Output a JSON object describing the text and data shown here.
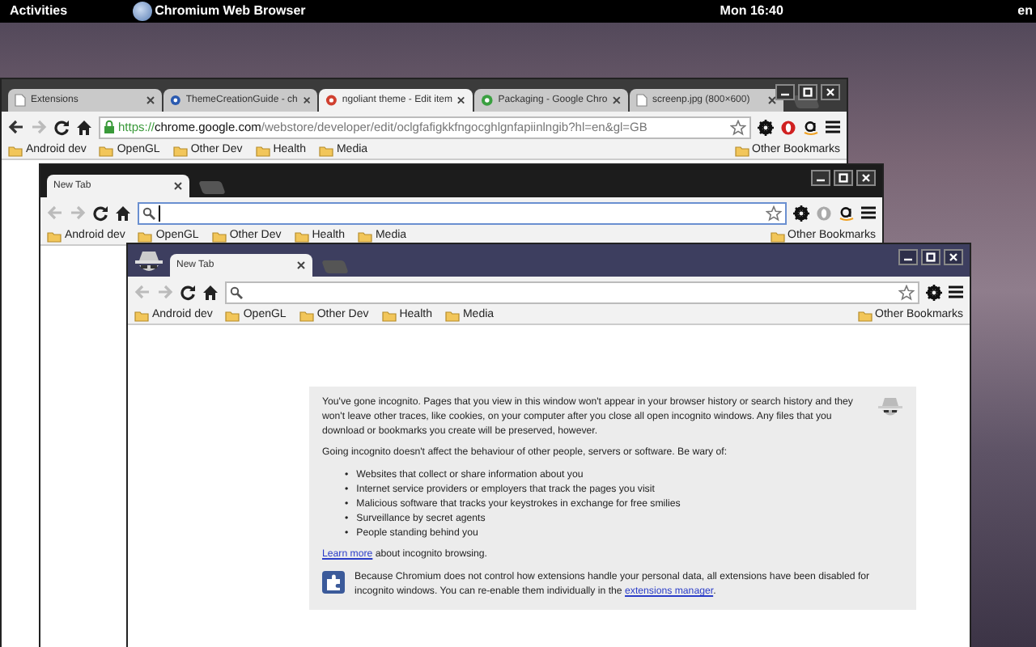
{
  "top_bar": {
    "activities": "Activities",
    "app_name": "Chromium Web Browser",
    "clock": "Mon 16:40",
    "keyboard": "en"
  },
  "windows": [
    {
      "incognito": false,
      "focused_omnibox": false,
      "tabs": [
        {
          "label": "Extensions",
          "selected": false
        },
        {
          "label": "ThemeCreationGuide - ch",
          "selected": false
        },
        {
          "label": "ngoliant theme - Edit item",
          "selected": true
        },
        {
          "label": "Packaging - Google Chro",
          "selected": false
        },
        {
          "label": "screenp.jpg (800×600)",
          "selected": false
        }
      ],
      "url_parts": [
        "https://",
        "chrome.google.com",
        "/webstore/developer/edit/oclgfafigkkfngocghlgnfapiinlngib?hl=en&gl=GB"
      ],
      "bookmarks": [
        "Android dev",
        "OpenGL",
        "Other Dev",
        "Health",
        "Media"
      ],
      "other_bookmarks": "Other Bookmarks"
    },
    {
      "incognito": false,
      "focused_omnibox": true,
      "tabs": [
        {
          "label": "New Tab",
          "selected": true
        }
      ],
      "bookmarks": [
        "Android dev",
        "OpenGL",
        "Other Dev",
        "Health",
        "Media"
      ],
      "other_bookmarks": "Other Bookmarks"
    },
    {
      "incognito": true,
      "focused_omnibox": false,
      "tabs": [
        {
          "label": "New Tab",
          "selected": true
        }
      ],
      "bookmarks": [
        "Android dev",
        "OpenGL",
        "Other Dev",
        "Health",
        "Media"
      ],
      "other_bookmarks": "Other Bookmarks",
      "incognito_page": {
        "intro": "You've gone incognito. Pages that you view in this window won't appear in your browser history or search history and they won't leave other traces, like cookies, on your computer after you close all open incognito windows. Any files that you download or bookmarks you create will be preserved, however.",
        "warning": "Going incognito doesn't affect the behaviour of other people, servers or software. Be wary of:",
        "risks": [
          {
            "bullet": "•",
            "text": "Websites that collect or share information about you"
          },
          {
            "bullet": "•",
            "text": "Internet service providers or employers that track the pages you visit"
          },
          {
            "bullet": "•",
            "text": "Malicious software that tracks your keystrokes in exchange for free smilies"
          },
          {
            "bullet": "•",
            "text": "Surveillance by secret agents"
          },
          {
            "bullet": "•",
            "text": "People standing behind you"
          }
        ],
        "learn_more": {
          "link": "Learn more",
          "text": " about incognito browsing."
        },
        "extensions_note": {
          "text": "Because Chromium does not control how extensions handle your personal data, all extensions have been disabled for incognito windows. You can re-enable them individually in the ",
          "link": "extensions manager",
          "end": "."
        }
      }
    }
  ]
}
